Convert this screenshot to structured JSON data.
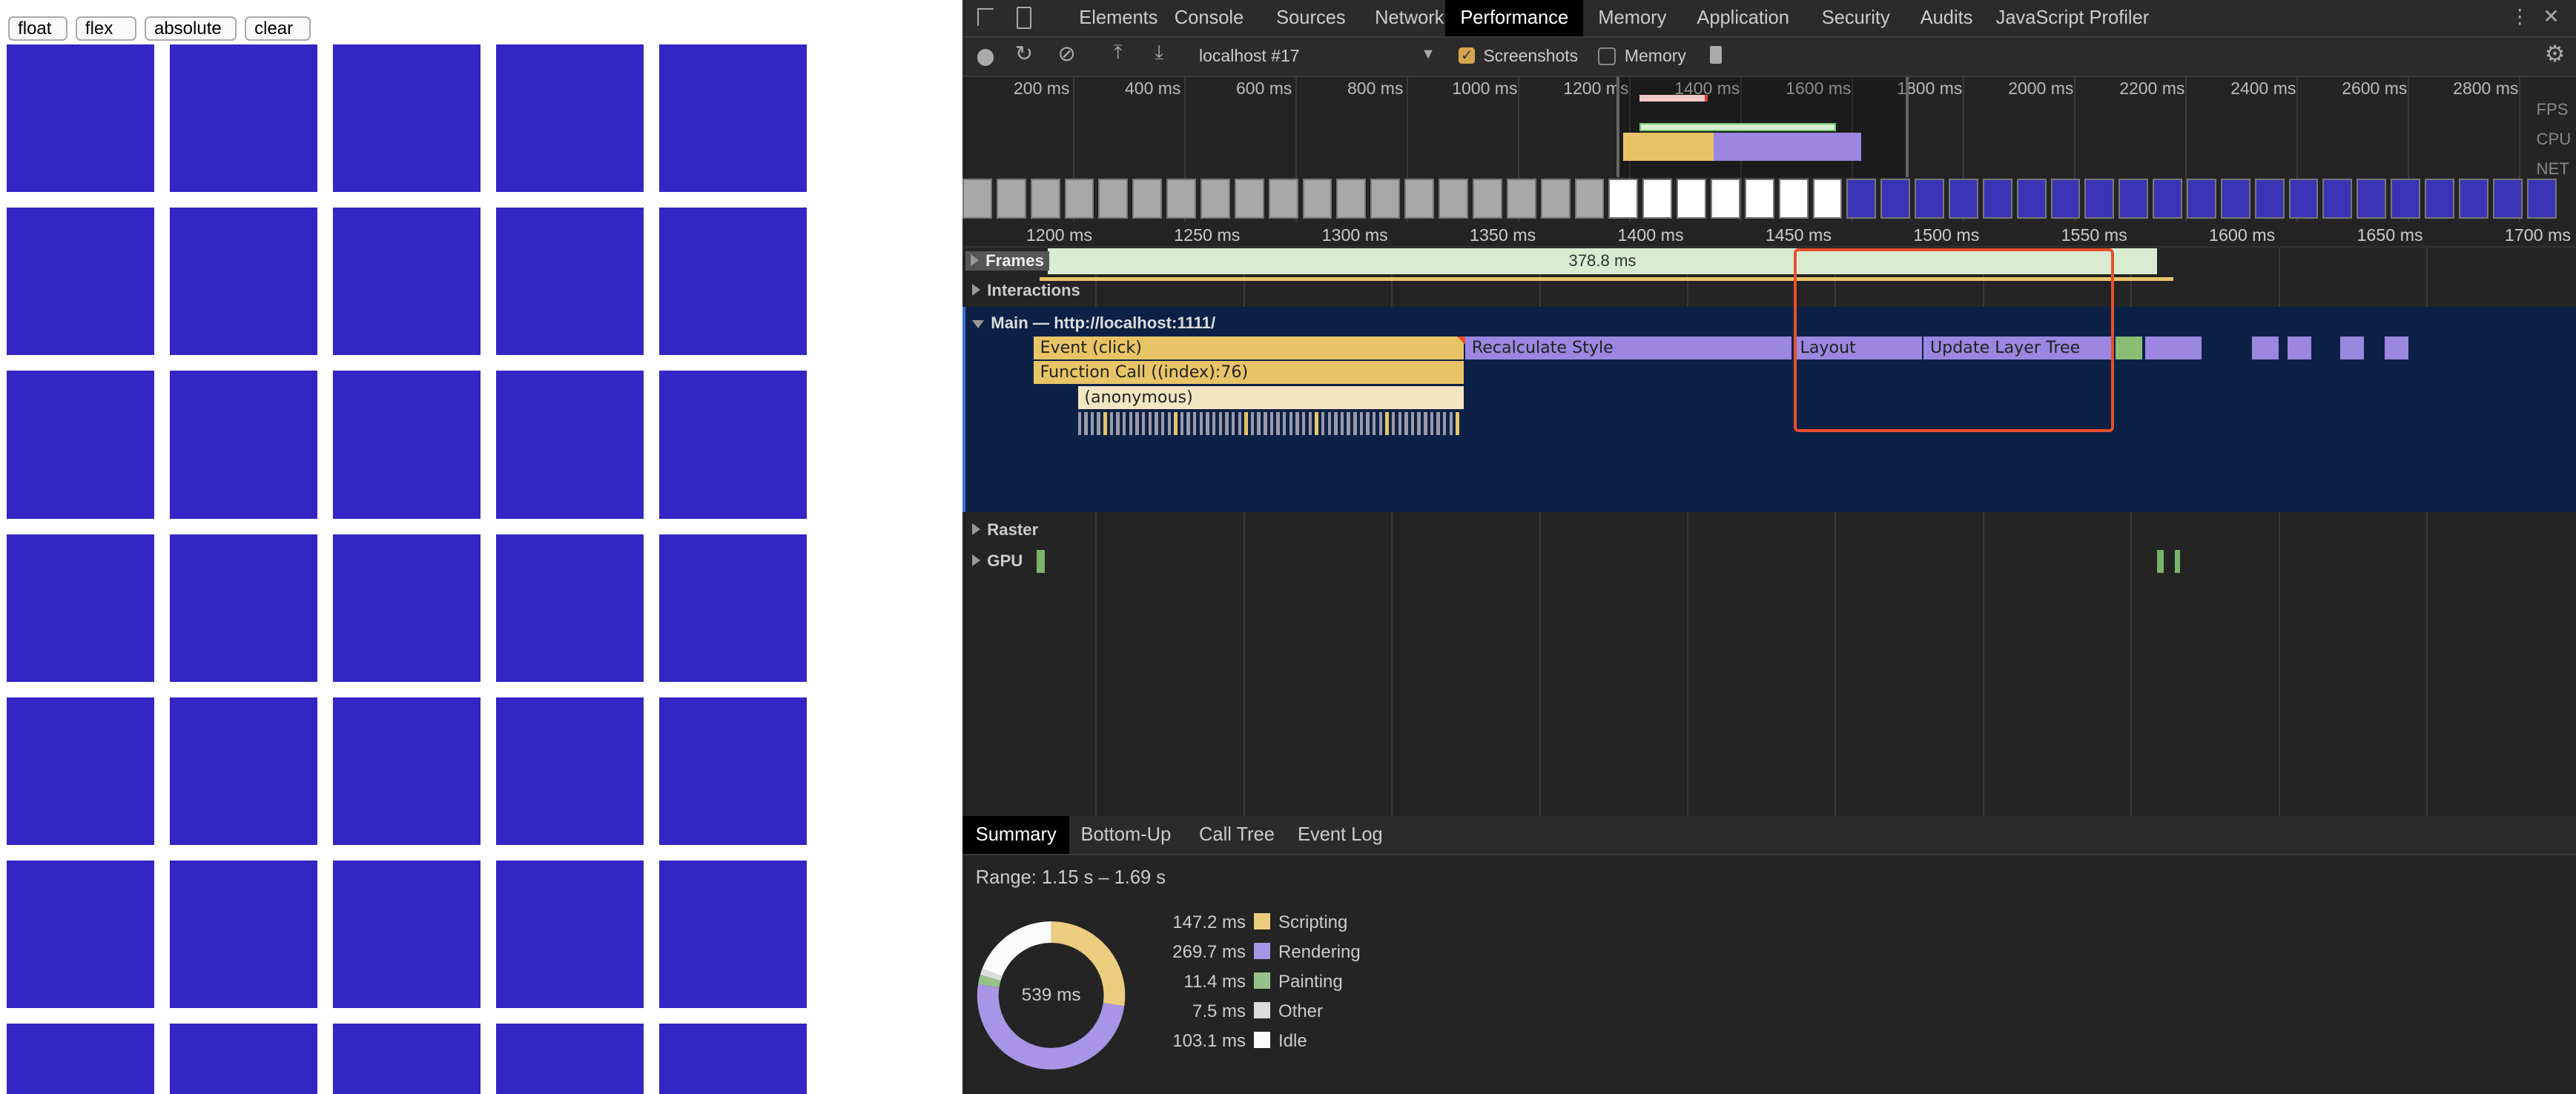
{
  "page": {
    "buttons": [
      "float",
      "flex",
      "absolute",
      "clear"
    ],
    "square_color": "#3326c4",
    "rows": 7,
    "cols": 5
  },
  "devtools": {
    "tabs": [
      "Elements",
      "Console",
      "Sources",
      "Network",
      "Performance",
      "Memory",
      "Application",
      "Security",
      "Audits",
      "JavaScript Profiler"
    ],
    "active_tab": "Performance",
    "toolbar": {
      "profile_select": "localhost #17",
      "screenshots_label": "Screenshots",
      "screenshots_checked": true,
      "memory_label": "Memory",
      "memory_checked": false
    },
    "overview": {
      "ticks": [
        "200 ms",
        "400 ms",
        "600 ms",
        "800 ms",
        "1000 ms",
        "1200 ms",
        "1400 ms",
        "1600 ms",
        "1800 ms",
        "2000 ms",
        "2200 ms",
        "2400 ms",
        "2600 ms",
        "2800 ms"
      ],
      "side_labels": [
        "FPS",
        "CPU",
        "NET"
      ]
    },
    "ruler": {
      "ticks": [
        "1200 ms",
        "1250 ms",
        "1300 ms",
        "1350 ms",
        "1400 ms",
        "1450 ms",
        "1500 ms",
        "1550 ms",
        "1600 ms",
        "1650 ms",
        "1700 ms"
      ]
    },
    "tracks": {
      "frames": "Frames",
      "frame_duration": "378.8 ms",
      "interactions": "Interactions",
      "main": "Main — http://localhost:1111/",
      "raster": "Raster",
      "gpu": "GPU"
    },
    "flame": [
      {
        "name": "Event (click)",
        "start": 1179,
        "end": 1325,
        "depth": 0,
        "color": "#e8c466"
      },
      {
        "name": "Function Call ((index):76)",
        "start": 1179,
        "end": 1325,
        "depth": 1,
        "color": "#e8c466"
      },
      {
        "name": "(anonymous)",
        "start": 1194,
        "end": 1325,
        "depth": 2,
        "color": "#f2e6c2"
      },
      {
        "name": "Recalculate Style",
        "start": 1325,
        "end": 1436,
        "depth": 0,
        "color": "#9b86e0"
      },
      {
        "name": "Layout",
        "start": 1436,
        "end": 1480,
        "depth": 0,
        "color": "#9b86e0"
      },
      {
        "name": "Update Layer Tree",
        "start": 1480,
        "end": 1545,
        "depth": 0,
        "color": "#9b86e0"
      }
    ],
    "bottom_tabs": [
      "Summary",
      "Bottom-Up",
      "Call Tree",
      "Event Log"
    ],
    "active_bottom_tab": "Summary",
    "summary": {
      "range": "Range: 1.15 s – 1.69 s",
      "total": "539 ms",
      "items": [
        {
          "value": "147.2 ms",
          "ms": 147.2,
          "label": "Scripting",
          "color": "#eccd7f"
        },
        {
          "value": "269.7 ms",
          "ms": 269.7,
          "label": "Rendering",
          "color": "#a995e5"
        },
        {
          "value": "11.4 ms",
          "ms": 11.4,
          "label": "Painting",
          "color": "#97c18a"
        },
        {
          "value": "7.5 ms",
          "ms": 7.5,
          "label": "Other",
          "color": "#dcdcdc"
        },
        {
          "value": "103.1 ms",
          "ms": 103.1,
          "label": "Idle",
          "color": "#fafafa"
        }
      ]
    },
    "highlight_color": "#e8502e"
  }
}
